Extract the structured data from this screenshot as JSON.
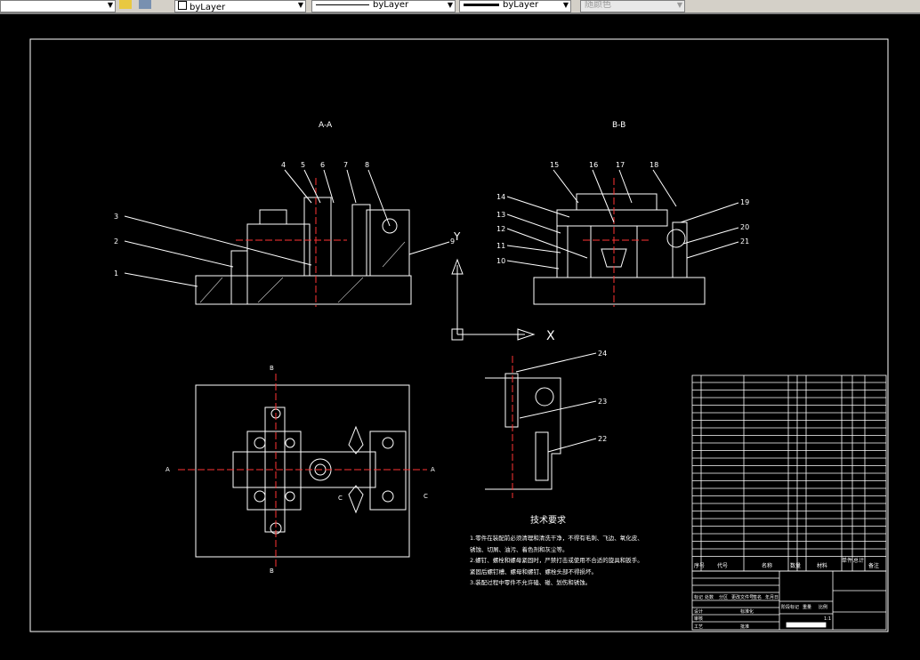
{
  "toolbar": {
    "layer_dropdown_arrow": "▼",
    "color": "byLayer",
    "linetype": "byLayer",
    "lineweight": "byLayer",
    "plot_style": "随颜色"
  },
  "drawing": {
    "section_aa": "A-A",
    "section_bb": "B-B",
    "callouts_aa": [
      "1",
      "2",
      "3",
      "4",
      "5",
      "6",
      "7",
      "8",
      "9"
    ],
    "callouts_bb": [
      "10",
      "11",
      "12",
      "13",
      "14",
      "15",
      "16",
      "17",
      "18",
      "19",
      "20",
      "21"
    ],
    "callouts_detail": [
      "22",
      "23",
      "24"
    ],
    "view_marks": {
      "a": "A",
      "b": "B",
      "c": "C"
    },
    "ucs_x": "X",
    "ucs_y": "Y",
    "tech_title": "技术要求",
    "tech_lines": [
      "1.零件在装配前必须清理和清洗干净，不得有毛刺、飞边、氧化皮、",
      "锈蚀、切屑、油污、着色剂和灰尘等。",
      "2.螺钉、螺栓和螺母紧固时，严禁打击或使用不合适的旋具和扳手。",
      "紧固后螺钉槽、螺母和螺钉、螺栓头部不得损坏。",
      "3.装配过程中零件不允许磕、碰、划伤和锈蚀。"
    ],
    "bom_headers": [
      "序号",
      "代号",
      "名称",
      "数量",
      "材料",
      "单件",
      "总计",
      "备注"
    ],
    "title_block": [
      "标记",
      "处数",
      "分区",
      "更改文件号",
      "签名",
      "年月日",
      "设计",
      "标准化",
      "审核",
      "工艺",
      "批准",
      "阶段标记",
      "重量",
      "比例",
      "1:1"
    ]
  }
}
